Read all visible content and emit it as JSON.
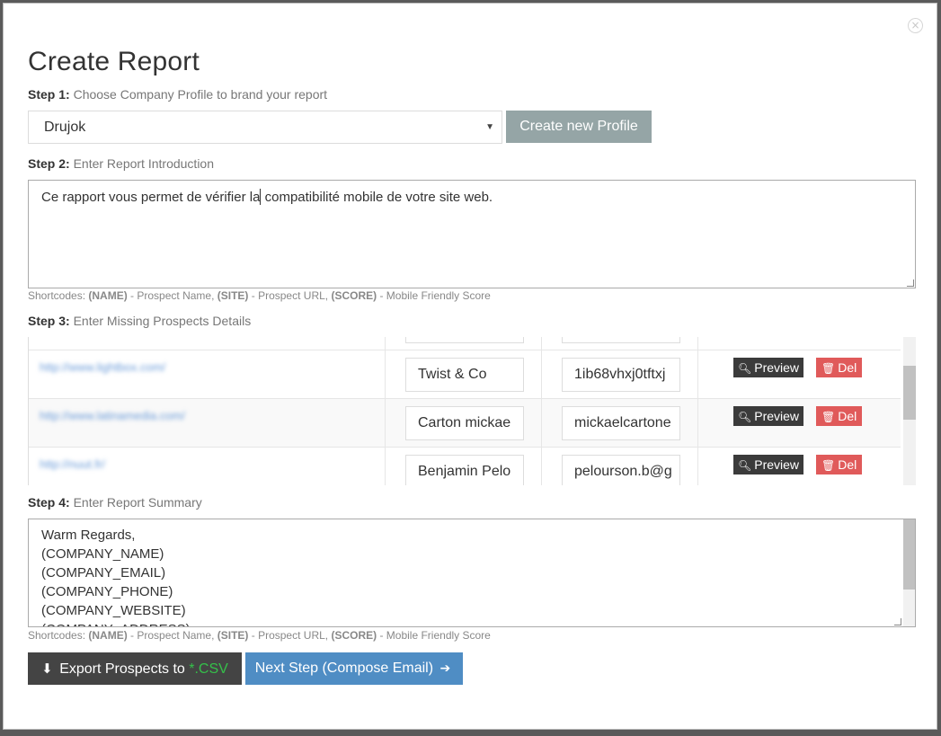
{
  "modal": {
    "title": "Create Report",
    "close_glyph": "×"
  },
  "step1": {
    "label": "Step 1:",
    "text": " Choose Company Profile to brand your report",
    "selected_profile": "Drujok",
    "create_profile_label": "Create new Profile"
  },
  "step2": {
    "label": "Step 2:",
    "text": " Enter Report Introduction",
    "intro_before_cursor": "Ce rapport vous permet de vérifier la",
    "intro_after_cursor": " compatibilité mobile de votre site web."
  },
  "shortcodes": {
    "label": "Shortcodes:",
    "name_code": "(NAME)",
    "name_desc": " - Prospect Name, ",
    "site_code": "(SITE)",
    "site_desc": " - Prospect URL, ",
    "score_code": "(SCORE)",
    "score_desc": " - Mobile Friendly Score"
  },
  "step3": {
    "label": "Step 3:",
    "text": " Enter Missing Prospects Details",
    "rows": [
      {
        "url": "http://www.lightbox.com/",
        "name": "Twist & Co",
        "email": "1ib68vhxj0tftxj"
      },
      {
        "url": "http://www.latinamedia.com/",
        "name": "Carton mickae",
        "email": "mickaelcartone"
      },
      {
        "url": "http://nuut.fr/",
        "name": "Benjamin Pelo",
        "email": "pelourson.b@g"
      }
    ],
    "preview_label": "Preview",
    "delete_label": "Del"
  },
  "step4": {
    "label": "Step 4:",
    "text": " Enter Report Summary",
    "summary_lines": [
      "Warm Regards,",
      "(COMPANY_NAME)",
      "(COMPANY_EMAIL)",
      "(COMPANY_PHONE)",
      "(COMPANY_WEBSITE)",
      "(COMPANY_ADDRESS)"
    ]
  },
  "footer": {
    "export_label": "Export Prospects to ",
    "export_ext": "*.CSV",
    "next_label": "Next Step (Compose Email)"
  },
  "colors": {
    "gray_button": "#95a5a6",
    "dark_button": "#444444",
    "blue_button": "#4f8dc4",
    "delete_button": "#e05a5a",
    "csv_green": "#35c04a"
  },
  "icons": {
    "select": "caret-down-icon",
    "preview": "search-icon",
    "delete": "trash-icon",
    "export": "download-icon",
    "next": "arrow-circle-right-icon",
    "close": "close-circle-icon"
  }
}
